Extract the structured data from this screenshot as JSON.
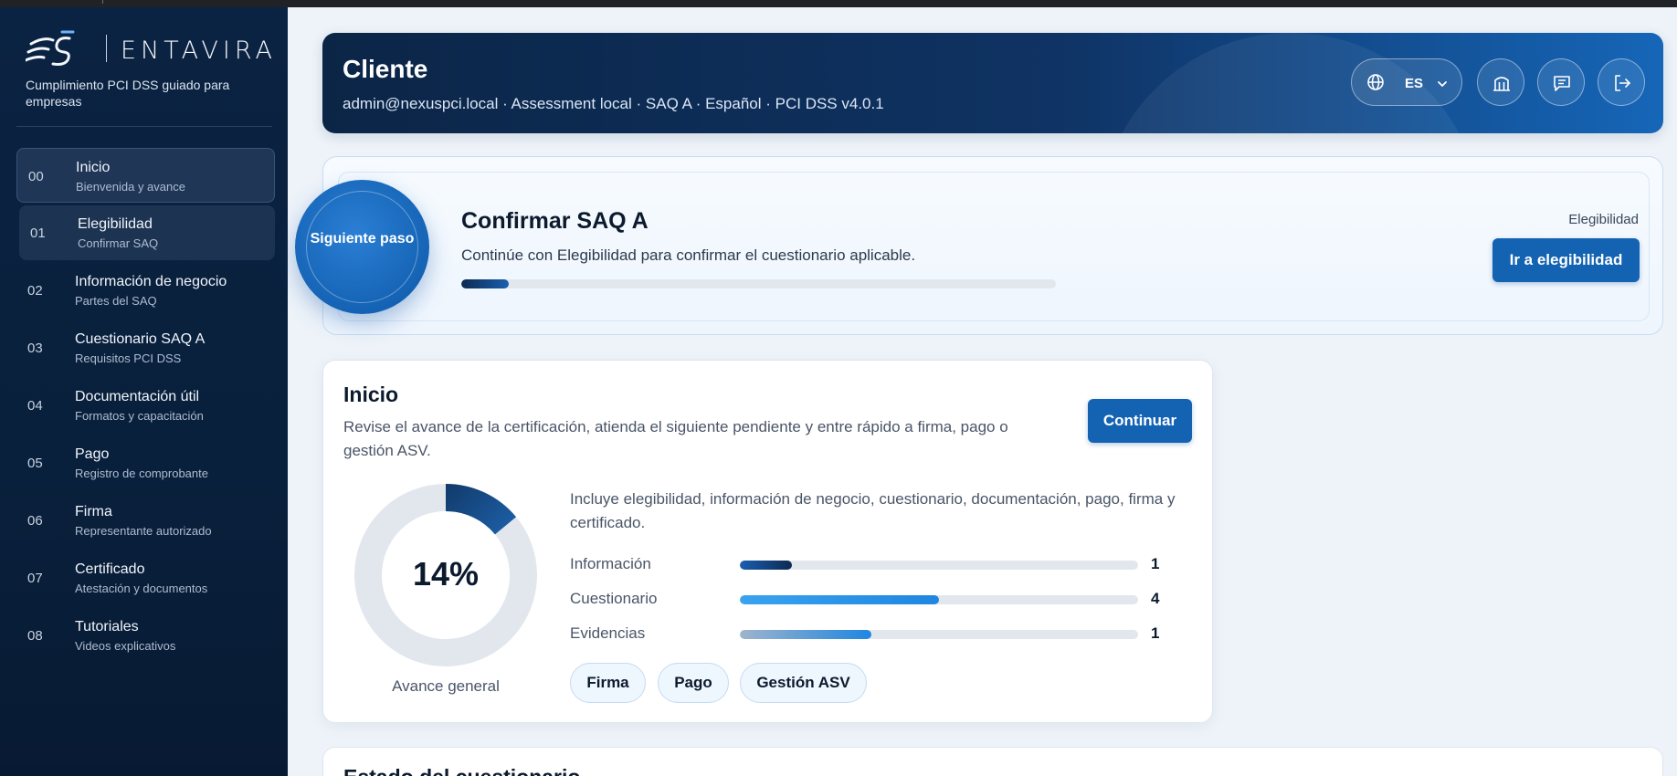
{
  "brand": {
    "name": "ENTAVIRA",
    "tagline": "Cumplimiento PCI DSS guiado para empresas"
  },
  "sidebar": {
    "items": [
      {
        "num": "00",
        "title": "Inicio",
        "sub": "Bienvenida y avance"
      },
      {
        "num": "01",
        "title": "Elegibilidad",
        "sub": "Confirmar SAQ"
      },
      {
        "num": "02",
        "title": "Información de negocio",
        "sub": "Partes del SAQ"
      },
      {
        "num": "03",
        "title": "Cuestionario SAQ A",
        "sub": "Requisitos PCI DSS"
      },
      {
        "num": "04",
        "title": "Documentación útil",
        "sub": "Formatos y capacitación"
      },
      {
        "num": "05",
        "title": "Pago",
        "sub": "Registro de comprobante"
      },
      {
        "num": "06",
        "title": "Firma",
        "sub": "Representante autorizado"
      },
      {
        "num": "07",
        "title": "Certificado",
        "sub": "Atestación y documentos"
      },
      {
        "num": "08",
        "title": "Tutoriales",
        "sub": "Videos explicativos"
      }
    ]
  },
  "header": {
    "title": "Cliente",
    "meta": "admin@nexuspci.local · Assessment local · SAQ A · Español · PCI DSS v4.0.1",
    "language": "ES",
    "icons": [
      "globe-icon",
      "chevron-down-icon",
      "building-icon",
      "chat-icon",
      "logout-icon"
    ]
  },
  "next_step": {
    "badge": "Siguiente paso",
    "title": "Confirmar SAQ A",
    "description": "Continúe con Elegibilidad para confirmar el cuestionario aplicable.",
    "progress": 0.08,
    "section_label": "Elegibilidad",
    "button": "Ir a elegibilidad"
  },
  "inicio": {
    "title": "Inicio",
    "description": "Revise el avance de la certificación, atienda el siguiente pendiente y entre rápido a firma, pago o gestión ASV.",
    "button": "Continuar",
    "overall_percent": 14,
    "overall_value": "14%",
    "overall_label": "Avance general",
    "includes": "Incluye elegibilidad, información de negocio, cuestionario, documentación, pago, firma y certificado.",
    "metrics": [
      {
        "label": "Información",
        "value": 1,
        "fill": 0.13,
        "color_start": "#1a5fb0",
        "color_end": "#0d2a52"
      },
      {
        "label": "Cuestionario",
        "value": 4,
        "fill": 0.5,
        "color_start": "#3aa3f0",
        "color_end": "#1f86e0"
      },
      {
        "label": "Evidencias",
        "value": 1,
        "fill": 0.33,
        "color_start": "#9fb4cc",
        "color_end": "#1f86e0"
      }
    ],
    "chips": [
      "Firma",
      "Pago",
      "Gestión ASV"
    ]
  },
  "next_section": {
    "title": "Estado del cuestionario"
  },
  "colors": {
    "sidebar_bg": "#0b2342",
    "primary": "#1463b3",
    "header_dark": "#0b2546",
    "header_light": "#1666b8"
  }
}
